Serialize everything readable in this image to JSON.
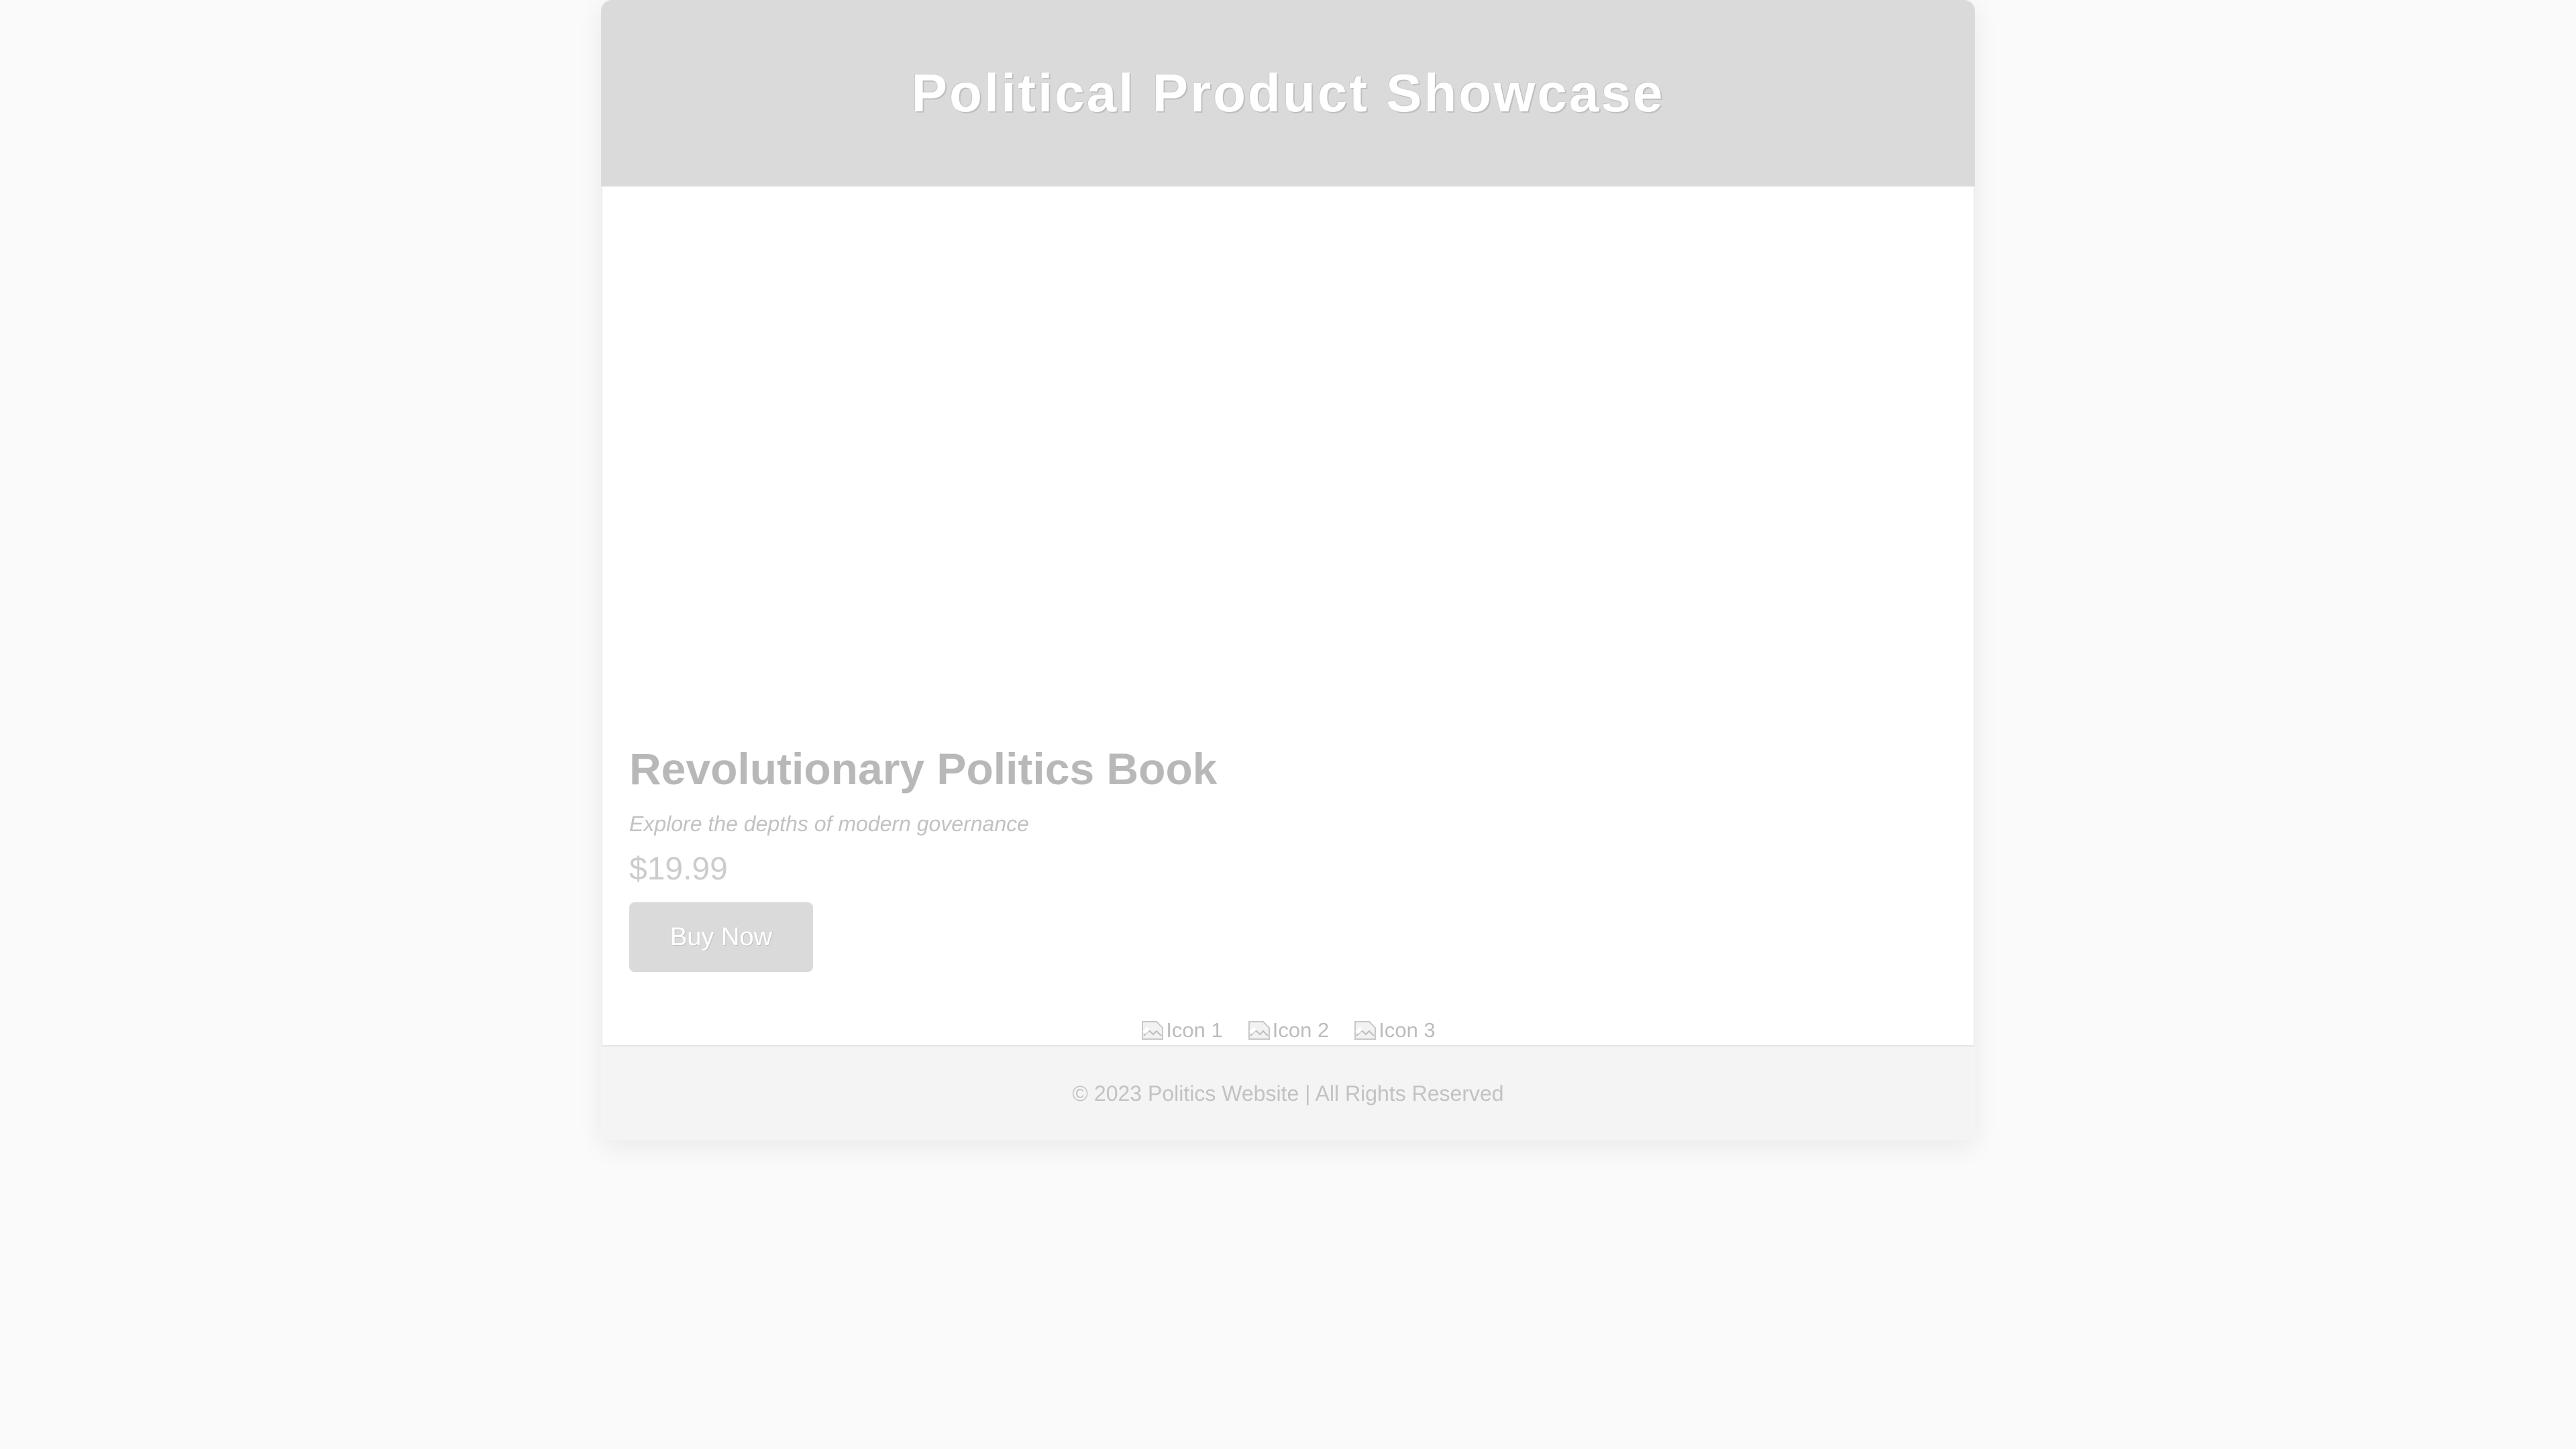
{
  "header": {
    "title": "Political Product Showcase"
  },
  "product": {
    "title": "Revolutionary Politics Book",
    "subtitle": "Explore the depths of modern governance",
    "price": "$19.99",
    "buy_label": "Buy Now"
  },
  "icons": [
    {
      "alt": "Icon 1",
      "icon": "broken-image-icon"
    },
    {
      "alt": "Icon 2",
      "icon": "broken-image-icon"
    },
    {
      "alt": "Icon 3",
      "icon": "broken-image-icon"
    }
  ],
  "footer": {
    "text": "© 2023 Politics Website | All Rights Reserved"
  },
  "colors": {
    "background": "#fafafa",
    "header": "#dadada",
    "button": "#dadada",
    "footer": "#f4f4f4"
  }
}
